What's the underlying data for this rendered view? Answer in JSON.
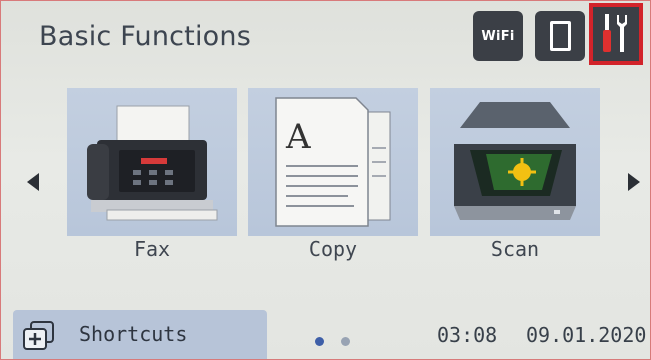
{
  "header": {
    "title": "Basic Functions",
    "wifi_label": "WiFi",
    "icons": [
      "wifi-icon",
      "device-icon",
      "settings-tools-icon"
    ]
  },
  "functions": [
    {
      "label": "Fax",
      "icon": "fax-machine-icon"
    },
    {
      "label": "Copy",
      "icon": "copy-documents-icon"
    },
    {
      "label": "Scan",
      "icon": "scanner-icon"
    }
  ],
  "navigation": {
    "left": "arrow-left-icon",
    "right": "arrow-right-icon"
  },
  "footer": {
    "shortcuts_label": "Shortcuts",
    "shortcuts_icon": "shortcuts-add-icon",
    "time": "03:08",
    "date": "09.01.2020",
    "page_count": 2,
    "active_page": 1
  },
  "colors": {
    "accent": "#d2232a",
    "tile_bg": "#bccadd",
    "header_btn": "#3b3f46",
    "active_dot": "#3e5fa8"
  }
}
